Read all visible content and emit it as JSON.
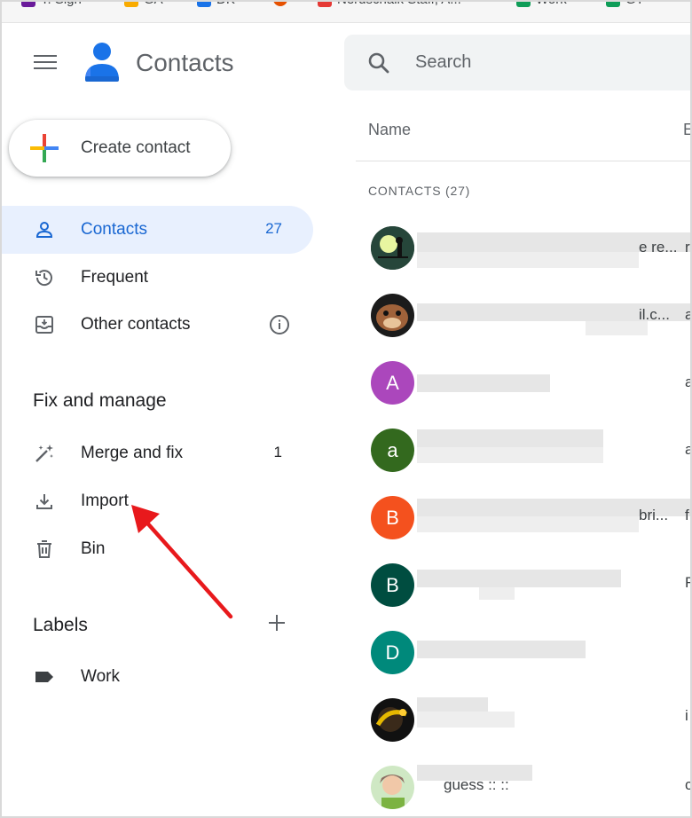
{
  "bookmarks": [
    {
      "label": "T. Sign",
      "color": "#6a1b9a"
    },
    {
      "label": "GA",
      "color": "#f9ab00"
    },
    {
      "label": "DK",
      "color": "#1a73e8"
    },
    {
      "label": "",
      "color": "#e65100"
    },
    {
      "label": "Nerdschalk Staff, A...",
      "color": "#e53935"
    },
    {
      "label": "Work",
      "color": "#0f9d58"
    },
    {
      "label": "GT",
      "color": "#0f9d58"
    }
  ],
  "header": {
    "app_title": "Contacts",
    "search_placeholder": "Search"
  },
  "sidebar": {
    "create_label": "Create contact",
    "items": [
      {
        "label": "Contacts",
        "count": "27"
      },
      {
        "label": "Frequent"
      },
      {
        "label": "Other contacts"
      }
    ],
    "fix_title": "Fix and manage",
    "fix_items": [
      {
        "label": "Merge and fix",
        "count": "1"
      },
      {
        "label": "Import"
      },
      {
        "label": "Bin"
      }
    ],
    "labels_title": "Labels",
    "labels": [
      {
        "label": "Work"
      }
    ]
  },
  "list": {
    "col_name": "Name",
    "col_email": "E",
    "heading": "CONTACTS (27)",
    "rows": [
      {
        "avatar": "photo-night",
        "initial": "",
        "color": "#2e4a3a",
        "text": "e re...",
        "edge": "r"
      },
      {
        "avatar": "photo-dog",
        "initial": "",
        "color": "#6d4c41",
        "text": "il.c...",
        "edge": "a"
      },
      {
        "avatar": "letter",
        "initial": "A",
        "color": "#ab47bc",
        "text": "",
        "edge": "a"
      },
      {
        "avatar": "letter",
        "initial": "a",
        "color": "#33691e",
        "text": "",
        "edge": "a"
      },
      {
        "avatar": "letter",
        "initial": "B",
        "color": "#f4511e",
        "text": "bri...",
        "edge": "f"
      },
      {
        "avatar": "letter",
        "initial": "B",
        "color": "#004d40",
        "text": "",
        "edge": "F"
      },
      {
        "avatar": "letter",
        "initial": "D",
        "color": "#00897b",
        "text": "",
        "edge": ""
      },
      {
        "avatar": "photo-dark",
        "initial": "",
        "color": "#3e2723",
        "text": "",
        "edge": "i"
      },
      {
        "avatar": "photo-kid",
        "initial": "",
        "color": "#a5d6a7",
        "text": "guess :: ::",
        "edge": "c"
      }
    ]
  },
  "colors": {
    "accent": "#1967d2",
    "active_bg": "#e8f0fe",
    "arrow": "#e8191c"
  }
}
